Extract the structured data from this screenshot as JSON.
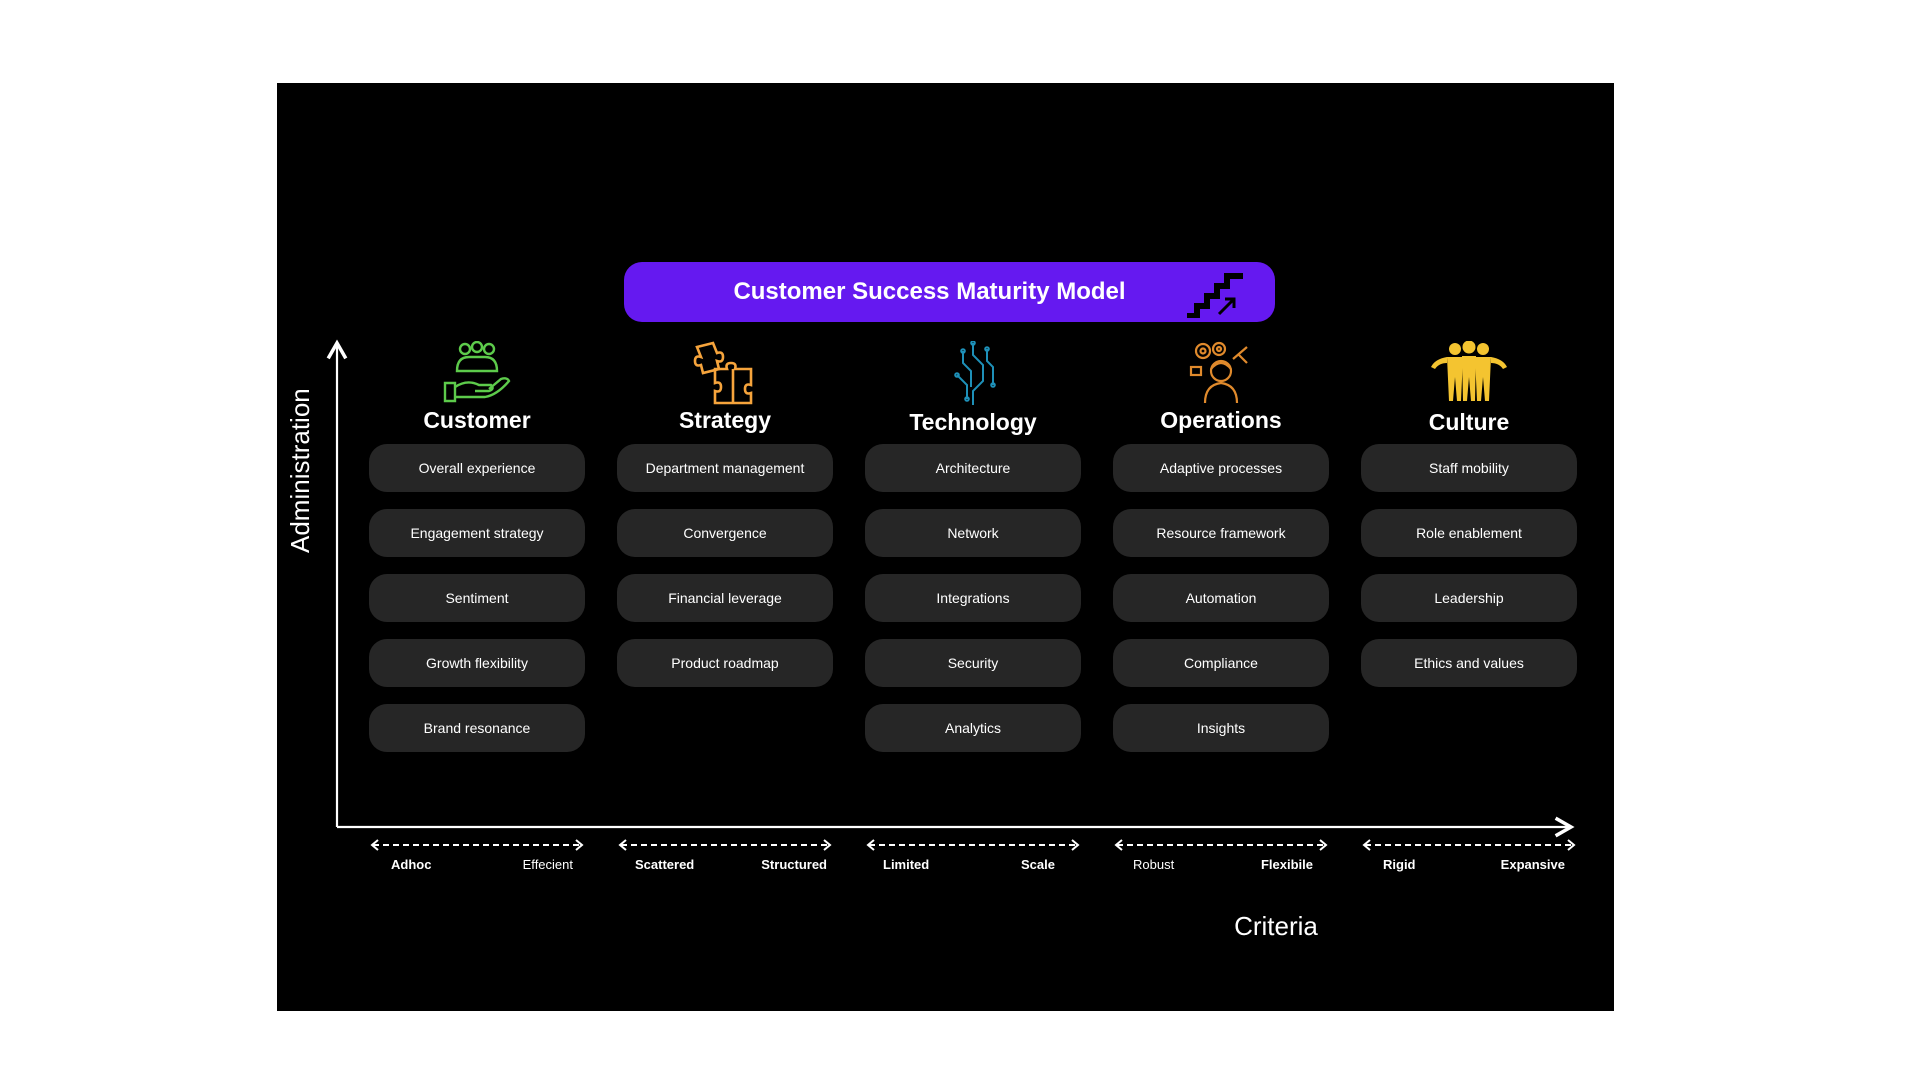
{
  "title": "Customer Success Maturity Model",
  "axes": {
    "x_label": "Criteria",
    "y_label": "Administration"
  },
  "colors": {
    "banner": "#6519F0",
    "pill": "#262626",
    "customer_icon": "#5DCB4B",
    "strategy_icon": "#F6A43C",
    "technology_icon": "#1E90B8",
    "operations_icon": "#E08A2C",
    "culture_icon": "#F4C430"
  },
  "columns": [
    {
      "name": "Customer",
      "icon": "hand-people-icon",
      "items": [
        "Overall experience",
        "Engagement strategy",
        "Sentiment",
        "Growth flexibility",
        "Brand resonance"
      ],
      "scale_low": "Adhoc",
      "scale_high": "Effecient"
    },
    {
      "name": "Strategy",
      "icon": "puzzle-icon",
      "items": [
        "Department management",
        "Convergence",
        "Financial leverage",
        "Product roadmap"
      ],
      "scale_low": "Scattered",
      "scale_high": "Structured"
    },
    {
      "name": "Technology",
      "icon": "circuit-icon",
      "items": [
        "Architecture",
        "Network",
        "Integrations",
        "Security",
        "Analytics"
      ],
      "scale_low": "Limited",
      "scale_high": "Scale"
    },
    {
      "name": "Operations",
      "icon": "operator-gears-icon",
      "items": [
        "Adaptive processes",
        "Resource framework",
        "Automation",
        "Compliance",
        "Insights"
      ],
      "scale_low": "Robust",
      "scale_high": "Flexibile"
    },
    {
      "name": "Culture",
      "icon": "team-icon",
      "items": [
        "Staff mobility",
        "Role enablement",
        "Leadership",
        "Ethics and values"
      ],
      "scale_low": "Rigid",
      "scale_high": "Expansive"
    }
  ]
}
